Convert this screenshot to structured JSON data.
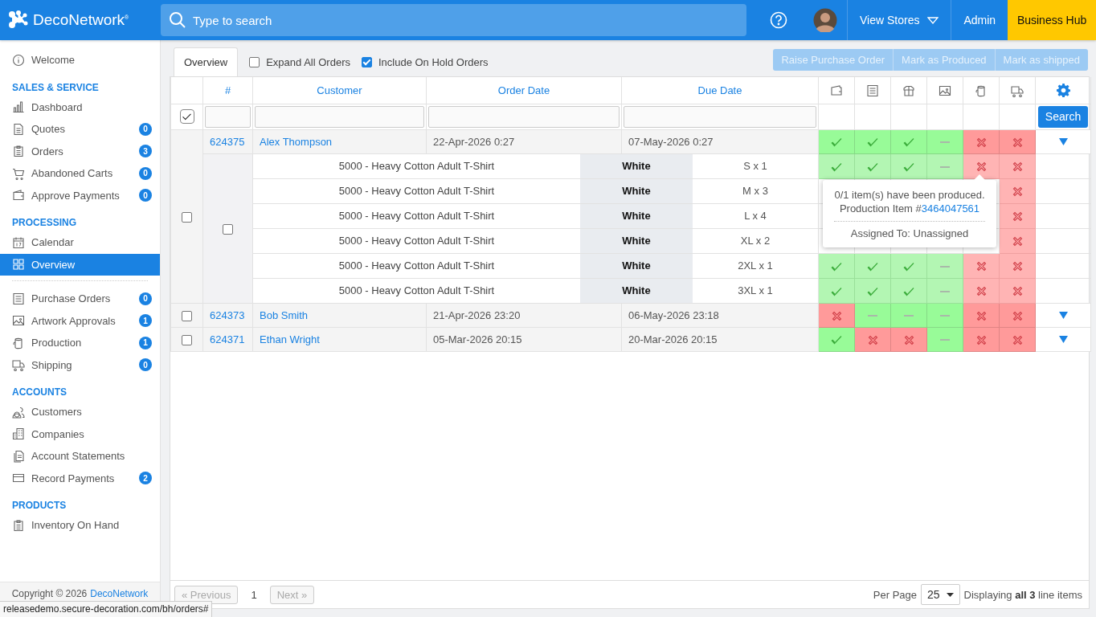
{
  "header": {
    "logo": "DecoNetwork$^{®}$",
    "search": {
      "placeholder": "Type to search"
    },
    "nav": [
      {
        "label": "View Stores",
        "kind": "dropdown"
      },
      {
        "label": "Admin",
        "kind": "link"
      },
      {
        "label": "Business Hub",
        "kind": "highlight"
      }
    ]
  },
  "sidebar": {
    "items": [
      {
        "label": "Welcome",
        "selected": false
      }
    ],
    "sections": [
      {
        "title": "SALES & SERVICE",
        "groups": [
          [
            {
              "label": "Dashboard",
              "selected": false
            },
            {
              "label": "Quotes",
              "badge": "0",
              "selected": false
            },
            {
              "label": "Orders",
              "badge": "3",
              "selected": false
            },
            {
              "label": "Abandoned Carts",
              "badge": "0",
              "selected": false
            },
            {
              "label": "Approve Payments",
              "badge": "0",
              "selected": false
            }
          ]
        ]
      },
      {
        "title": "PROCESSING",
        "groups": [
          [
            {
              "label": "Calendar",
              "selected": false
            },
            {
              "label": "Overview",
              "selected": true
            }
          ],
          [
            {
              "label": "Purchase Orders",
              "badge": "0",
              "selected": false
            },
            {
              "label": "Artwork Approvals",
              "badge": "1",
              "selected": false
            },
            {
              "label": "Production",
              "badge": "1",
              "selected": false
            },
            {
              "label": "Shipping",
              "badge": "0",
              "selected": false
            }
          ]
        ]
      },
      {
        "title": "ACCOUNTS",
        "groups": [
          [
            {
              "label": "Customers",
              "selected": false
            },
            {
              "label": "Companies",
              "selected": false
            },
            {
              "label": "Account Statements",
              "selected": false
            },
            {
              "label": "Record Payments",
              "badge": "2",
              "selected": false
            }
          ]
        ]
      },
      {
        "title": "PRODUCTS",
        "groups": [
          [
            {
              "label": "Inventory On Hand",
              "selected": false
            }
          ]
        ]
      }
    ],
    "footer": {
      "text": "Copyright © 2026",
      "link": "DecoNetwork"
    }
  },
  "toolbar": {
    "tabs": [
      {
        "label": "Overview",
        "selected": true
      }
    ],
    "options": [
      {
        "label": "Expand All Orders",
        "checked": false
      },
      {
        "label": "Include On Hold Orders",
        "checked": true
      }
    ],
    "buttons": [
      {
        "label": "Raise Purchase Order",
        "disabled": true
      },
      {
        "label": "Mark as Produced",
        "disabled": true
      },
      {
        "label": "Mark as shipped",
        "disabled": true
      }
    ]
  },
  "table": {
    "columns": [
      "#",
      "Customer",
      "Order Date",
      "Due Date"
    ],
    "select_all": {
      "checked": true
    },
    "search_button": "Search",
    "orders": [
      {
        "number": "624375",
        "customer": "Alex Thompson",
        "order_date": "22-Apr-2026 0:27",
        "due_date": "07-May-2026 0:27",
        "checked": false,
        "statuses": [
          {
            "kind": "check"
          },
          {
            "kind": "check"
          },
          {
            "kind": "check"
          },
          {
            "kind": "dash"
          },
          {
            "kind": "cross"
          },
          {
            "kind": "cross"
          }
        ],
        "group_checked": false,
        "lines": [
          {
            "product": "5000 - Heavy Cotton Adult T-Shirt",
            "color_name": "White",
            "size": "S x 1",
            "statuses": [
              {
                "kind": "check"
              },
              {
                "kind": "check"
              },
              {
                "kind": "check"
              },
              {
                "kind": "dash"
              },
              {
                "kind": "cross"
              },
              {
                "kind": "cross"
              }
            ]
          },
          {
            "product": "5000 - Heavy Cotton Adult T-Shirt",
            "color_name": "White",
            "size": "M x 3",
            "statuses": [
              {
                "kind": "cross"
              }
            ]
          },
          {
            "product": "5000 - Heavy Cotton Adult T-Shirt",
            "color_name": "White",
            "size": "L x 4",
            "statuses": [
              {
                "kind": "cross"
              }
            ]
          },
          {
            "product": "5000 - Heavy Cotton Adult T-Shirt",
            "color_name": "White",
            "size": "XL x 2",
            "statuses": [
              {
                "kind": "cross"
              }
            ]
          },
          {
            "product": "5000 - Heavy Cotton Adult T-Shirt",
            "color_name": "White",
            "size": "2XL x 1",
            "statuses": [
              {
                "kind": "check"
              },
              {
                "kind": "check"
              },
              {
                "kind": "check"
              },
              {
                "kind": "dash"
              },
              {
                "kind": "cross"
              },
              {
                "kind": "cross"
              }
            ]
          },
          {
            "product": "5000 - Heavy Cotton Adult T-Shirt",
            "color_name": "White",
            "size": "3XL x 1",
            "statuses": [
              {
                "kind": "check"
              },
              {
                "kind": "check"
              },
              {
                "kind": "check"
              },
              {
                "kind": "dash"
              },
              {
                "kind": "cross"
              },
              {
                "kind": "cross"
              }
            ]
          }
        ]
      },
      {
        "number": "624373",
        "customer": "Bob Smith",
        "order_date": "21-Apr-2026 23:20",
        "due_date": "06-May-2026 23:18",
        "checked": false,
        "statuses": [
          {
            "kind": "cross"
          },
          {
            "kind": "dash"
          },
          {
            "kind": "dash"
          },
          {
            "kind": "dash"
          },
          {
            "kind": "cross"
          },
          {
            "kind": "cross"
          }
        ]
      },
      {
        "number": "624371",
        "customer": "Ethan Wright",
        "order_date": "05-Mar-2026 20:15",
        "due_date": "20-Mar-2026 20:15",
        "checked": false,
        "statuses": [
          {
            "kind": "check"
          },
          {
            "kind": "cross"
          },
          {
            "kind": "cross"
          },
          {
            "kind": "dash"
          },
          {
            "kind": "cross"
          },
          {
            "kind": "cross"
          }
        ]
      }
    ],
    "tooltip": {
      "line_1": "0/1 item(s) have been produced.",
      "line_2": "Production Item #",
      "link": "3464047561",
      "line_3": "Assigned To: Unassigned"
    }
  },
  "pager": {
    "previous": "« Previous",
    "page": "1",
    "next": "Next »",
    "per_page_label": "Per Page",
    "per_page": "25",
    "summary": "Displaying **all 3** line items"
  },
  "status_bar": {
    "url": "releasedemo.secure-decoration.com/bh/orders#"
  }
}
